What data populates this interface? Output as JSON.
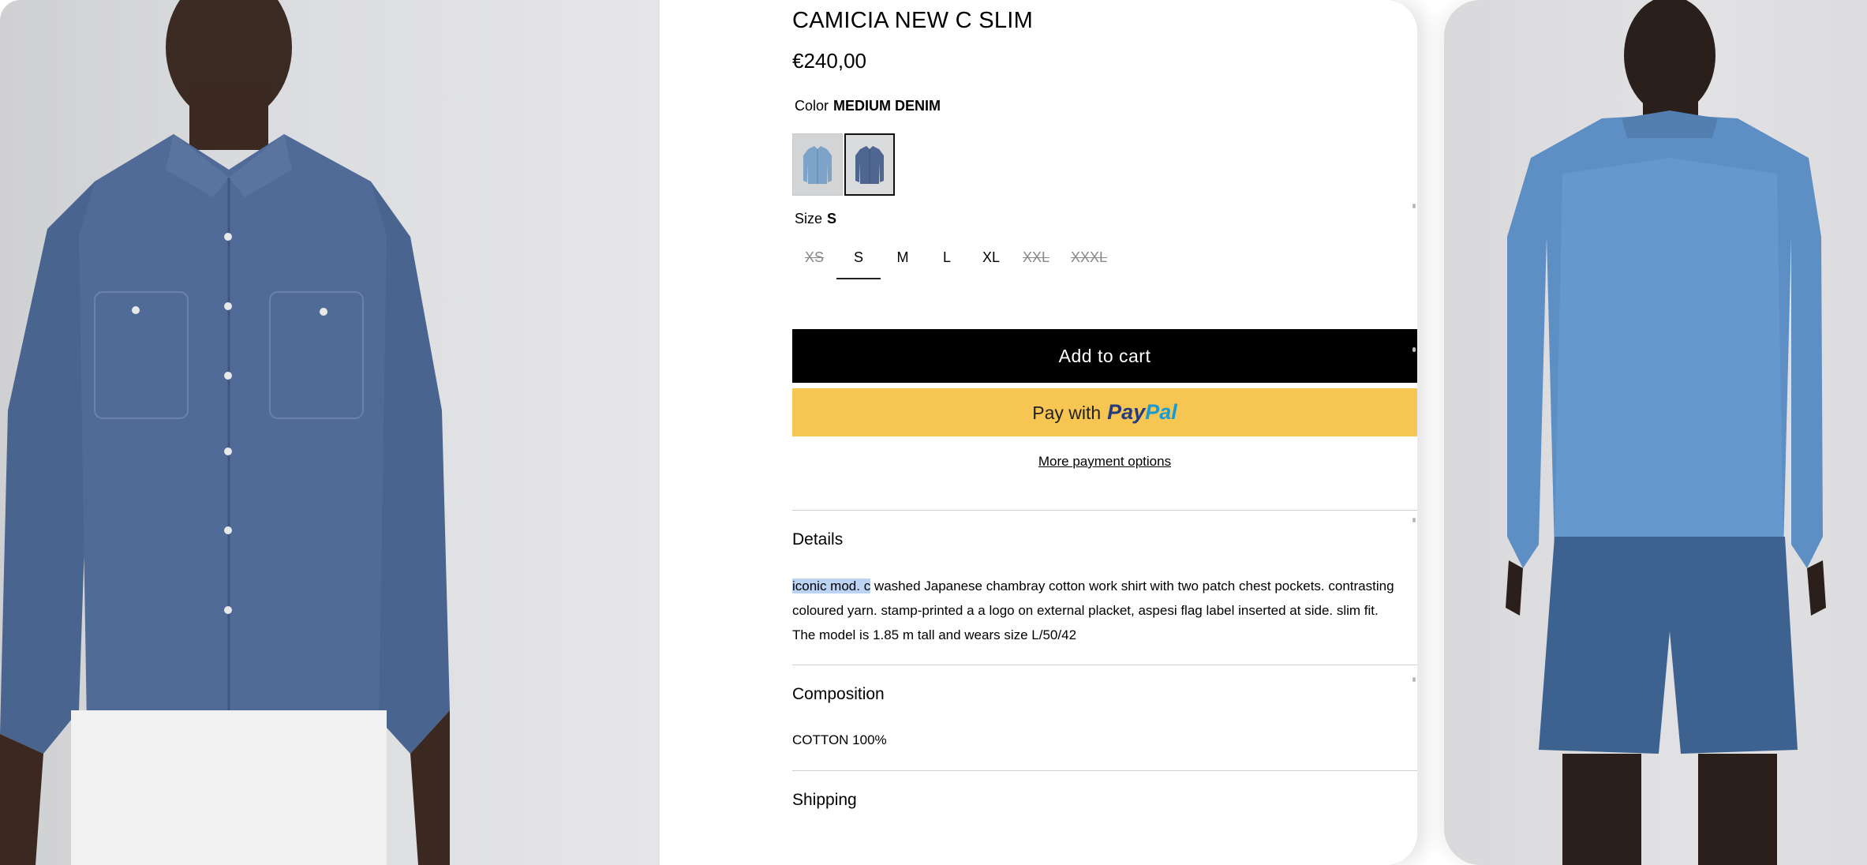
{
  "product": {
    "title": "CAMICIA NEW C SLIM",
    "price": "€240,00",
    "color_label": "Color",
    "color_value": "MEDIUM DENIM",
    "size_label": "Size",
    "size_value": "S",
    "sizes": [
      {
        "label": "XS",
        "available": false,
        "selected": false
      },
      {
        "label": "S",
        "available": true,
        "selected": true
      },
      {
        "label": "M",
        "available": true,
        "selected": false
      },
      {
        "label": "L",
        "available": true,
        "selected": false
      },
      {
        "label": "XL",
        "available": true,
        "selected": false
      },
      {
        "label": "XXL",
        "available": false,
        "selected": false
      },
      {
        "label": "XXXL",
        "available": false,
        "selected": false
      }
    ],
    "swatches": [
      {
        "name": "light-denim",
        "selected": false,
        "color": "#7ea3c9"
      },
      {
        "name": "medium-denim",
        "selected": true,
        "color": "#4f6690"
      }
    ]
  },
  "buttons": {
    "add_to_cart": "Add to cart",
    "paypal_prefix": "Pay with",
    "paypal_brand_1": "Pay",
    "paypal_brand_2": "Pal",
    "more_payment": "More payment options"
  },
  "details": {
    "title": "Details",
    "highlight": "iconic mod. c",
    "text_line1": " washed Japanese chambray cotton work shirt with two patch chest pockets. contrasting",
    "text_line2": "coloured yarn. stamp-printed a a logo on external placket, aspesi flag label inserted at side. slim fit.",
    "text_line3": "The model is 1.85 m tall and wears size L/50/42"
  },
  "composition": {
    "title": "Composition",
    "value": "COTTON 100%"
  },
  "shipping": {
    "title": "Shipping"
  },
  "colors": {
    "paypal_yellow": "#f6c552",
    "cart_black": "#000000",
    "highlight_blue": "#bcd3f3"
  }
}
